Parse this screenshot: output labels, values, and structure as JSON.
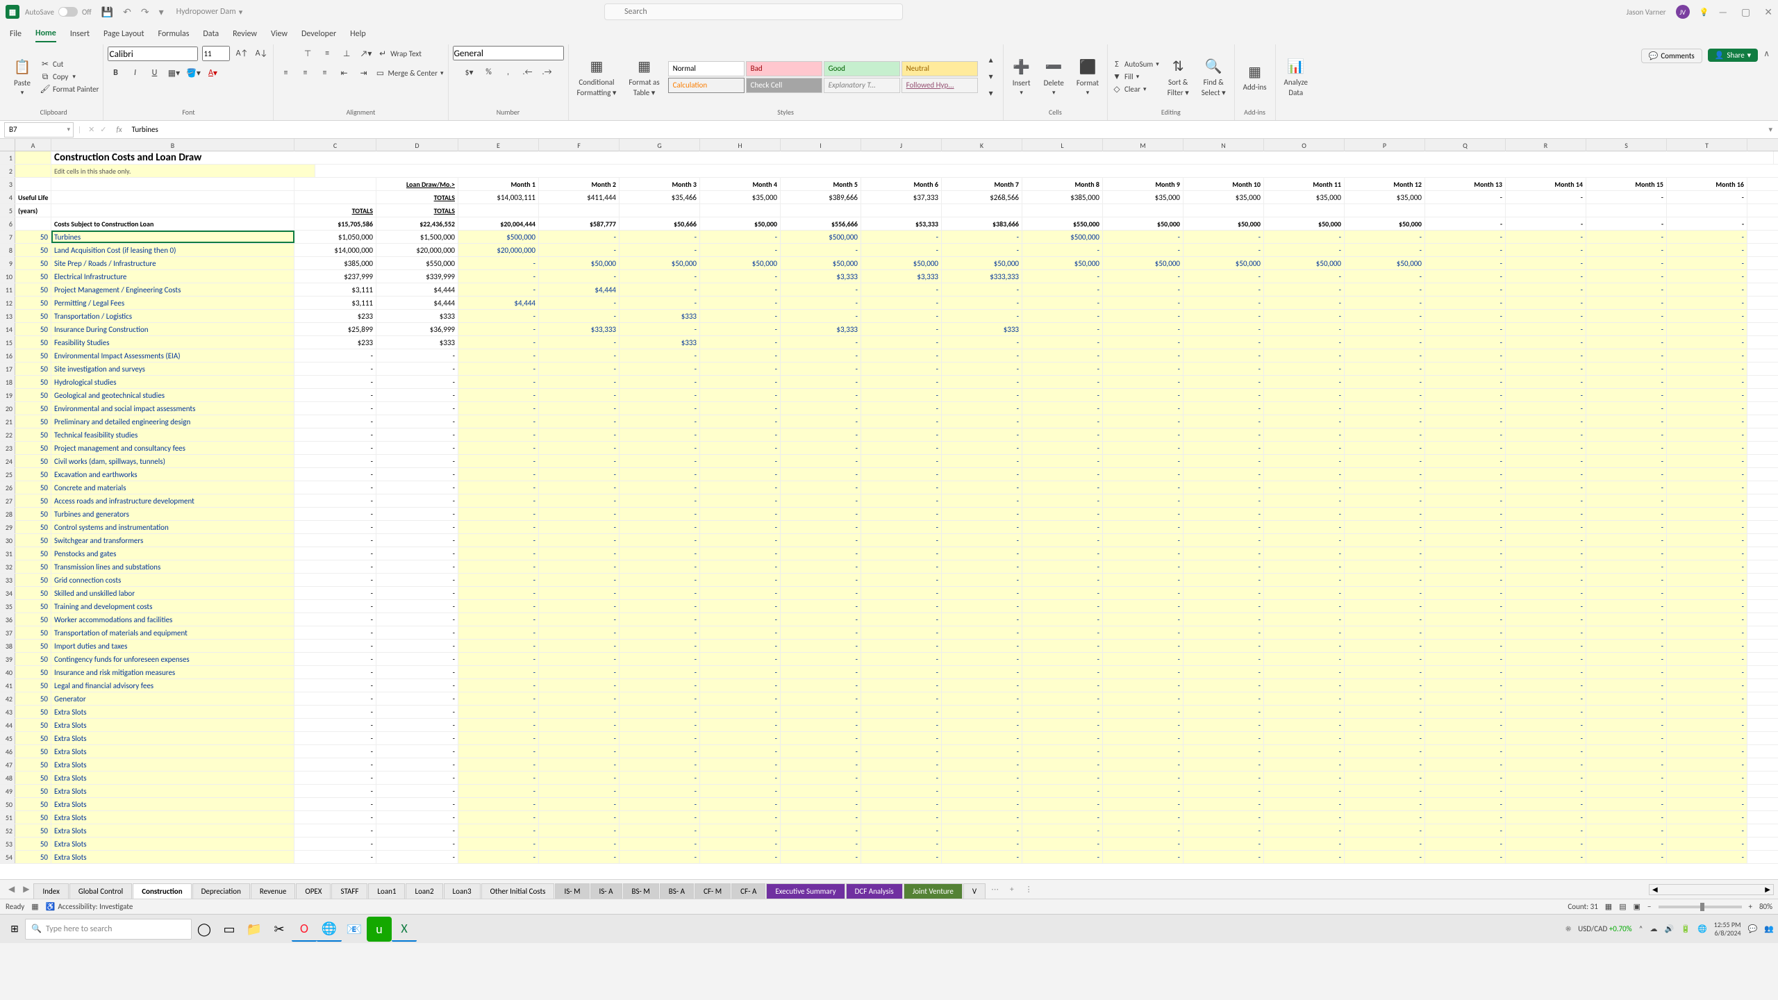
{
  "title": {
    "autosave": "AutoSave",
    "autosave_state": "Off",
    "docname": "Hydropower Dam",
    "search_placeholder": "Search",
    "user": "Jason Varner",
    "initials": "JV"
  },
  "tabs": [
    "File",
    "Home",
    "Insert",
    "Page Layout",
    "Formulas",
    "Data",
    "Review",
    "View",
    "Developer",
    "Help"
  ],
  "active_tab": 1,
  "ribbon": {
    "clipboard": {
      "paste": "Paste",
      "cut": "Cut",
      "copy": "Copy",
      "painter": "Format Painter",
      "label": "Clipboard"
    },
    "font": {
      "name": "Calibri",
      "size": "11",
      "label": "Font"
    },
    "align": {
      "wrap": "Wrap Text",
      "merge": "Merge & Center",
      "label": "Alignment"
    },
    "number": {
      "general": "General",
      "label": "Number"
    },
    "styles": {
      "cond": "Conditional\nFormatting",
      "cond1": "Conditional",
      "cond2": "Formatting",
      "fas": "Format as\nTable",
      "fas1": "Format as",
      "fas2": "Table",
      "normal": "Normal",
      "bad": "Bad",
      "good": "Good",
      "neutral": "Neutral",
      "calc": "Calculation",
      "check": "Check Cell",
      "exp": "Explanatory T...",
      "hyp": "Followed Hyp...",
      "label": "Styles"
    },
    "cells": {
      "insert": "Insert",
      "delete": "Delete",
      "format": "Format",
      "label": "Cells"
    },
    "editing": {
      "autosum": "AutoSum",
      "fill": "Fill",
      "clear": "Clear",
      "sort": "Sort &\nFilter",
      "sort1": "Sort &",
      "sort2": "Filter",
      "find": "Find &\nSelect",
      "find1": "Find &",
      "find2": "Select",
      "label": "Editing"
    },
    "addins": {
      "addins": "Add-ins",
      "label": "Add-ins"
    },
    "analyze": {
      "label1": "Analyze",
      "label2": "Data"
    },
    "comments": "Comments",
    "share": "Share"
  },
  "fbar": {
    "ref": "B7",
    "value": "Turbines"
  },
  "sheet": {
    "title": "Construction Costs and Loan Draw",
    "edit_note": "Edit cells in this shade only.",
    "useful_life": "Useful Life",
    "years": "(years)",
    "costs_subj": "Costs Subject to Construction Loan",
    "totals": "TOTALS",
    "loan_draw_totals": "Loan Draw/Mo.>",
    "loan_draw_totals2": "TOTALS",
    "months": [
      "Month 1",
      "Month 2",
      "Month 3",
      "Month 4",
      "Month 5",
      "Month 6",
      "Month 7",
      "Month 8",
      "Month 9",
      "Month 10",
      "Month 11",
      "Month 12",
      "Month 13",
      "Month 14",
      "Month 15",
      "Month 16"
    ],
    "month_totals": [
      "$14,003,111",
      "$411,444",
      "$35,466",
      "$35,000",
      "$389,666",
      "$37,333",
      "$268,566",
      "$385,000",
      "$35,000",
      "$35,000",
      "$35,000",
      "$35,000",
      "-",
      "-",
      "-",
      "-"
    ],
    "row6": [
      "$15,705,586",
      "$22,436,552",
      "$20,004,444",
      "$587,777",
      "$50,666",
      "$50,000",
      "$556,666",
      "$53,333",
      "$383,666",
      "$550,000",
      "$50,000",
      "$50,000",
      "$50,000",
      "$50,000",
      "-",
      "-",
      "-",
      "-"
    ],
    "items": [
      {
        "n": "Turbines",
        "ul": "50",
        "tot": "$1,050,000",
        "ld": "$1,500,000",
        "vals": [
          "$500,000",
          "-",
          "-",
          "-",
          "$500,000",
          "-",
          "-",
          "$500,000",
          "-",
          "-",
          "-",
          "-",
          "-",
          "-",
          "-",
          "-"
        ]
      },
      {
        "n": "Land Acquisition Cost (if leasing then 0)",
        "ul": "50",
        "tot": "$14,000,000",
        "ld": "$20,000,000",
        "vals": [
          "$20,000,000",
          "-",
          "-",
          "-",
          "-",
          "-",
          "-",
          "-",
          "-",
          "-",
          "-",
          "-",
          "-",
          "-",
          "-",
          "-"
        ]
      },
      {
        "n": "Site Prep / Roads / Infrastructure",
        "ul": "50",
        "tot": "$385,000",
        "ld": "$550,000",
        "vals": [
          "-",
          "$50,000",
          "$50,000",
          "$50,000",
          "$50,000",
          "$50,000",
          "$50,000",
          "$50,000",
          "$50,000",
          "$50,000",
          "$50,000",
          "$50,000",
          "-",
          "-",
          "-",
          "-"
        ]
      },
      {
        "n": "Electrical Infrastructure",
        "ul": "50",
        "tot": "$237,999",
        "ld": "$339,999",
        "vals": [
          "-",
          "-",
          "-",
          "-",
          "$3,333",
          "$3,333",
          "$333,333",
          "-",
          "-",
          "-",
          "-",
          "-",
          "-",
          "-",
          "-",
          "-"
        ]
      },
      {
        "n": "Project Management / Engineering Costs",
        "ul": "50",
        "tot": "$3,111",
        "ld": "$4,444",
        "vals": [
          "-",
          "$4,444",
          "-",
          "-",
          "-",
          "-",
          "-",
          "-",
          "-",
          "-",
          "-",
          "-",
          "-",
          "-",
          "-",
          "-"
        ]
      },
      {
        "n": "Permitting / Legal Fees",
        "ul": "50",
        "tot": "$3,111",
        "ld": "$4,444",
        "vals": [
          "$4,444",
          "-",
          "-",
          "-",
          "-",
          "-",
          "-",
          "-",
          "-",
          "-",
          "-",
          "-",
          "-",
          "-",
          "-",
          "-"
        ]
      },
      {
        "n": "Transportation / Logistics",
        "ul": "50",
        "tot": "$233",
        "ld": "$333",
        "vals": [
          "-",
          "-",
          "$333",
          "-",
          "-",
          "-",
          "-",
          "-",
          "-",
          "-",
          "-",
          "-",
          "-",
          "-",
          "-",
          "-"
        ]
      },
      {
        "n": "Insurance During Construction",
        "ul": "50",
        "tot": "$25,899",
        "ld": "$36,999",
        "vals": [
          "-",
          "$33,333",
          "-",
          "-",
          "$3,333",
          "-",
          "$333",
          "-",
          "-",
          "-",
          "-",
          "-",
          "-",
          "-",
          "-",
          "-"
        ]
      },
      {
        "n": "Feasibility Studies",
        "ul": "50",
        "tot": "$233",
        "ld": "$333",
        "vals": [
          "-",
          "-",
          "$333",
          "-",
          "-",
          "-",
          "-",
          "-",
          "-",
          "-",
          "-",
          "-",
          "-",
          "-",
          "-",
          "-"
        ]
      },
      {
        "n": "Environmental Impact Assessments (EIA)",
        "ul": "50",
        "tot": "-",
        "ld": "-"
      },
      {
        "n": "Site investigation and surveys",
        "ul": "50",
        "tot": "-",
        "ld": "-"
      },
      {
        "n": "Hydrological studies",
        "ul": "50",
        "tot": "-",
        "ld": "-"
      },
      {
        "n": "Geological and geotechnical studies",
        "ul": "50",
        "tot": "-",
        "ld": "-"
      },
      {
        "n": "Environmental and social impact assessments",
        "ul": "50",
        "tot": "-",
        "ld": "-"
      },
      {
        "n": "Preliminary and detailed engineering design",
        "ul": "50",
        "tot": "-",
        "ld": "-"
      },
      {
        "n": "Technical feasibility studies",
        "ul": "50",
        "tot": "-",
        "ld": "-"
      },
      {
        "n": "Project management and consultancy fees",
        "ul": "50",
        "tot": "-",
        "ld": "-"
      },
      {
        "n": "Civil works (dam, spillways, tunnels)",
        "ul": "50",
        "tot": "-",
        "ld": "-"
      },
      {
        "n": "Excavation and earthworks",
        "ul": "50",
        "tot": "-",
        "ld": "-"
      },
      {
        "n": "Concrete and materials",
        "ul": "50",
        "tot": "-",
        "ld": "-"
      },
      {
        "n": "Access roads and infrastructure development",
        "ul": "50",
        "tot": "-",
        "ld": "-"
      },
      {
        "n": "Turbines and generators",
        "ul": "50",
        "tot": "-",
        "ld": "-"
      },
      {
        "n": "Control systems and instrumentation",
        "ul": "50",
        "tot": "-",
        "ld": "-"
      },
      {
        "n": "Switchgear and transformers",
        "ul": "50",
        "tot": "-",
        "ld": "-"
      },
      {
        "n": "Penstocks and gates",
        "ul": "50",
        "tot": "-",
        "ld": "-"
      },
      {
        "n": "Transmission lines and substations",
        "ul": "50",
        "tot": "-",
        "ld": "-"
      },
      {
        "n": "Grid connection costs",
        "ul": "50",
        "tot": "-",
        "ld": "-"
      },
      {
        "n": "Skilled and unskilled labor",
        "ul": "50",
        "tot": "-",
        "ld": "-"
      },
      {
        "n": "Training and development costs",
        "ul": "50",
        "tot": "-",
        "ld": "-"
      },
      {
        "n": "Worker accommodations and facilities",
        "ul": "50",
        "tot": "-",
        "ld": "-"
      },
      {
        "n": "Transportation of materials and equipment",
        "ul": "50",
        "tot": "-",
        "ld": "-"
      },
      {
        "n": "Import duties and taxes",
        "ul": "50",
        "tot": "-",
        "ld": "-"
      },
      {
        "n": "Contingency funds for unforeseen expenses",
        "ul": "50",
        "tot": "-",
        "ld": "-"
      },
      {
        "n": "Insurance and risk mitigation measures",
        "ul": "50",
        "tot": "-",
        "ld": "-"
      },
      {
        "n": "Legal and financial advisory fees",
        "ul": "50",
        "tot": "-",
        "ld": "-"
      },
      {
        "n": "Generator",
        "ul": "50",
        "tot": "-",
        "ld": "-"
      },
      {
        "n": "Extra Slots",
        "ul": "50",
        "tot": "-",
        "ld": "-"
      },
      {
        "n": "Extra Slots",
        "ul": "50",
        "tot": "-",
        "ld": "-"
      },
      {
        "n": "Extra Slots",
        "ul": "50",
        "tot": "-",
        "ld": "-"
      },
      {
        "n": "Extra Slots",
        "ul": "50",
        "tot": "-",
        "ld": "-"
      },
      {
        "n": "Extra Slots",
        "ul": "50",
        "tot": "-",
        "ld": "-"
      },
      {
        "n": "Extra Slots",
        "ul": "50",
        "tot": "-",
        "ld": "-"
      },
      {
        "n": "Extra Slots",
        "ul": "50",
        "tot": "-",
        "ld": "-"
      },
      {
        "n": "Extra Slots",
        "ul": "50",
        "tot": "-",
        "ld": "-"
      },
      {
        "n": "Extra Slots",
        "ul": "50",
        "tot": "-",
        "ld": "-"
      },
      {
        "n": "Extra Slots",
        "ul": "50",
        "tot": "-",
        "ld": "-"
      },
      {
        "n": "Extra Slots",
        "ul": "50",
        "tot": "-",
        "ld": "-"
      },
      {
        "n": "Extra Slots",
        "ul": "50",
        "tot": "-",
        "ld": "-"
      }
    ]
  },
  "sheet_tabs": [
    "Index",
    "Global Control",
    "Construction",
    "Depreciation",
    "Revenue",
    "OPEX",
    "STAFF",
    "Loan1",
    "Loan2",
    "Loan3",
    "Other Initial Costs",
    "IS- M",
    "IS- A",
    "BS- M",
    "BS- A",
    "CF- M",
    "CF- A",
    "Executive Summary",
    "DCF Analysis",
    "Joint Venture",
    "V"
  ],
  "active_sheet": 2,
  "status": {
    "ready": "Ready",
    "acc": "Accessibility: Investigate",
    "count": "Count: 31",
    "zoom": "80%"
  },
  "taskbar": {
    "search": "Type here to search",
    "currency": "USD/CAD",
    "change": "+0.70%",
    "time": "12:55 PM",
    "date": "6/8/2024"
  },
  "cols": [
    "A",
    "B",
    "C",
    "D",
    "E",
    "F",
    "G",
    "H",
    "I",
    "J",
    "K",
    "L",
    "M",
    "N",
    "O",
    "P",
    "Q",
    "R",
    "S",
    "T"
  ]
}
